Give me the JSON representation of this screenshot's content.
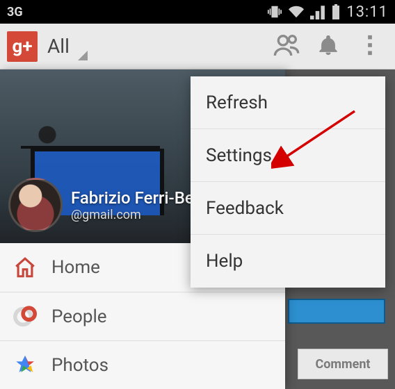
{
  "status_bar": {
    "network_label": "3G",
    "clock": "13:11"
  },
  "action_bar": {
    "logo_text": "g+",
    "spinner_label": "All"
  },
  "drawer": {
    "user": {
      "name": "Fabrizio Ferri-Bene",
      "email": "@gmail.com"
    },
    "items": [
      {
        "id": "home",
        "label": "Home"
      },
      {
        "id": "people",
        "label": "People"
      },
      {
        "id": "photos",
        "label": "Photos"
      }
    ]
  },
  "bg": {
    "comment_button_label": "Comment"
  },
  "overflow_menu": {
    "items": [
      {
        "id": "refresh",
        "label": "Refresh"
      },
      {
        "id": "settings",
        "label": "Settings"
      },
      {
        "id": "feedback",
        "label": "Feedback"
      },
      {
        "id": "help",
        "label": "Help"
      }
    ]
  }
}
